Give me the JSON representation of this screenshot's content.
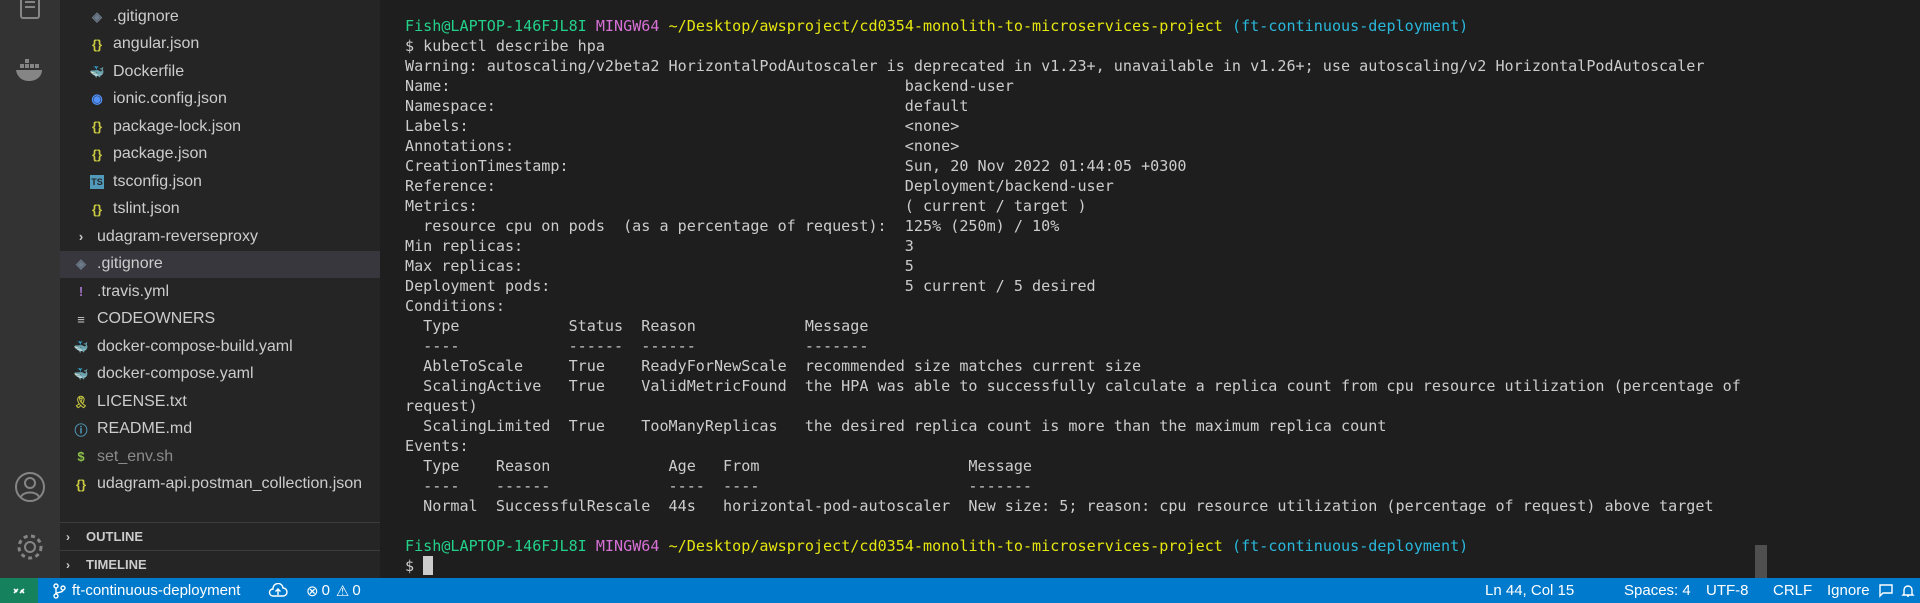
{
  "explorer": {
    "files": [
      {
        "name": ".gitignore",
        "icon": "git-icon",
        "glyph": "◈",
        "color": "#6c7a89",
        "indent": 1
      },
      {
        "name": "angular.json",
        "icon": "json-braces-icon",
        "glyph": "{}",
        "color": "#cbcb41",
        "indent": 1
      },
      {
        "name": "Dockerfile",
        "icon": "docker-whale-icon",
        "glyph": "🐳",
        "color": "#519aba",
        "indent": 1
      },
      {
        "name": "ionic.config.json",
        "icon": "ionic-icon",
        "glyph": "◉",
        "color": "#4f8ff7",
        "indent": 1
      },
      {
        "name": "package-lock.json",
        "icon": "json-braces-icon",
        "glyph": "{}",
        "color": "#cbcb41",
        "indent": 1
      },
      {
        "name": "package.json",
        "icon": "json-braces-icon",
        "glyph": "{}",
        "color": "#cbcb41",
        "indent": 1
      },
      {
        "name": "tsconfig.json",
        "icon": "typescript-icon",
        "glyph": "TS",
        "color": "#519aba",
        "indent": 1
      },
      {
        "name": "tslint.json",
        "icon": "json-braces-icon",
        "glyph": "{}",
        "color": "#cbcb41",
        "indent": 1
      },
      {
        "name": "udagram-reverseproxy",
        "icon": "chevron-right-icon",
        "glyph": "›",
        "color": "#cccccc",
        "indent": 0
      },
      {
        "name": ".gitignore",
        "icon": "git-icon",
        "glyph": "◈",
        "color": "#6c7a89",
        "indent": 0,
        "selected": true
      },
      {
        "name": ".travis.yml",
        "icon": "yaml-exclamation-icon",
        "glyph": "!",
        "color": "#a074c4",
        "indent": 0
      },
      {
        "name": "CODEOWNERS",
        "icon": "list-lines-icon",
        "glyph": "≡",
        "color": "#cccccc",
        "indent": 0
      },
      {
        "name": "docker-compose-build.yaml",
        "icon": "docker-compose-icon",
        "glyph": "🐳",
        "color": "#e3455f",
        "indent": 0
      },
      {
        "name": "docker-compose.yaml",
        "icon": "docker-compose-icon",
        "glyph": "🐳",
        "color": "#e3455f",
        "indent": 0
      },
      {
        "name": "LICENSE.txt",
        "icon": "license-icon",
        "glyph": "🎗",
        "color": "#cbcb41",
        "indent": 0
      },
      {
        "name": "README.md",
        "icon": "info-icon",
        "glyph": "ⓘ",
        "color": "#519aba",
        "indent": 0
      },
      {
        "name": "set_env.sh",
        "icon": "shell-dollar-icon",
        "glyph": "$",
        "color": "#8dc149",
        "indent": 0,
        "dim": true
      },
      {
        "name": "udagram-api.postman_collection.json",
        "icon": "json-braces-icon",
        "glyph": "{}",
        "color": "#cbcb41",
        "indent": 0
      }
    ],
    "sections": [
      {
        "label": "OUTLINE"
      },
      {
        "label": "TIMELINE"
      }
    ]
  },
  "terminal": {
    "prompt1": {
      "user": "Fish@LAPTOP-146FJL8I",
      "system": "MINGW64",
      "path": "~/Desktop/awsproject/cd0354-monolith-to-microservices-project",
      "branch": "(ft-continuous-deployment)"
    },
    "command": "$ kubectl describe hpa",
    "output": [
      "Warning: autoscaling/v2beta2 HorizontalPodAutoscaler is deprecated in v1.23+, unavailable in v1.26+; use autoscaling/v2 HorizontalPodAutoscaler",
      "Name:                                                  backend-user",
      "Namespace:                                             default",
      "Labels:                                                <none>",
      "Annotations:                                           <none>",
      "CreationTimestamp:                                     Sun, 20 Nov 2022 01:44:05 +0300",
      "Reference:                                             Deployment/backend-user",
      "Metrics:                                               ( current / target )",
      "  resource cpu on pods  (as a percentage of request):  125% (250m) / 10%",
      "Min replicas:                                          3",
      "Max replicas:                                          5",
      "Deployment pods:                                       5 current / 5 desired",
      "Conditions:",
      "  Type            Status  Reason            Message",
      "  ----            ------  ------            -------",
      "  AbleToScale     True    ReadyForNewScale  recommended size matches current size",
      "  ScalingActive   True    ValidMetricFound  the HPA was able to successfully calculate a replica count from cpu resource utilization (percentage of",
      "request)",
      "  ScalingLimited  True    TooManyReplicas   the desired replica count is more than the maximum replica count",
      "Events:",
      "  Type    Reason             Age   From                       Message",
      "  ----    ------             ----  ----                       -------",
      "  Normal  SuccessfulRescale  44s   horizontal-pod-autoscaler  New size: 5; reason: cpu resource utilization (percentage of request) above target",
      ""
    ],
    "prompt2": {
      "user": "Fish@LAPTOP-146FJL8I",
      "system": "MINGW64",
      "path": "~/Desktop/awsproject/cd0354-monolith-to-microservices-project",
      "branch": "(ft-continuous-deployment)"
    },
    "input_prompt": "$ "
  },
  "statusbar": {
    "branch": "ft-continuous-deployment",
    "errors": "0",
    "warnings": "0",
    "position": "Ln 44, Col 15",
    "spaces": "Spaces: 4",
    "encoding": "UTF-8",
    "eol": "CRLF",
    "language": "Ignore"
  },
  "colors": {
    "statusbar": "#007acc",
    "remote": "#16825d",
    "prompt_user": "#23d18b",
    "prompt_system": "#d670d6",
    "prompt_path": "#e5e510",
    "prompt_branch": "#29b8db"
  }
}
